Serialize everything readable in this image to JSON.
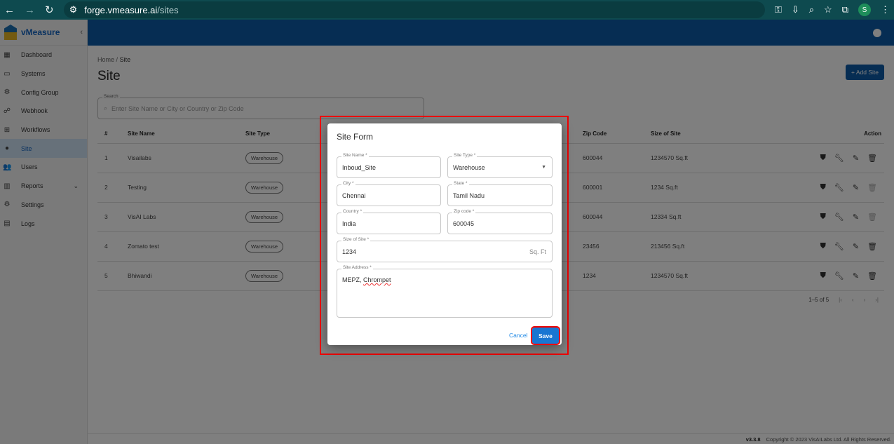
{
  "browser": {
    "url_host": "forge.vmeasure.ai",
    "url_path": "/sites",
    "profile": "S"
  },
  "sidebar": {
    "brand": "vMeasure",
    "items": [
      {
        "label": "Dashboard",
        "icon": "dashboard-icon"
      },
      {
        "label": "Systems",
        "icon": "devices-icon"
      },
      {
        "label": "Config Group",
        "icon": "gear-icon"
      },
      {
        "label": "Webhook",
        "icon": "webhook-icon"
      },
      {
        "label": "Workflows",
        "icon": "workflow-icon"
      },
      {
        "label": "Site",
        "icon": "location-icon",
        "active": true
      },
      {
        "label": "Users",
        "icon": "users-icon"
      },
      {
        "label": "Reports",
        "icon": "chart-icon"
      },
      {
        "label": "Settings",
        "icon": "gear-icon"
      },
      {
        "label": "Logs",
        "icon": "logs-icon"
      }
    ]
  },
  "page": {
    "breadcrumb_home": "Home",
    "breadcrumb_sep": "/",
    "breadcrumb_current": "Site",
    "title": "Site",
    "add_button": "+ Add Site",
    "search_label": "Search",
    "search_placeholder": "Enter Site Name or City or Country or Zip Code"
  },
  "table": {
    "headers": [
      "#",
      "Site Name",
      "Site Type",
      "Zip Code",
      "Size of Site",
      "Action"
    ],
    "rows": [
      {
        "n": "1",
        "name": "Visailabs",
        "type": "Warehouse",
        "zip": "600044",
        "size": "1234570 Sq.ft",
        "delete_enabled": true
      },
      {
        "n": "2",
        "name": "Testing",
        "type": "Warehouse",
        "zip": "600001",
        "size": "1234 Sq.ft",
        "delete_enabled": false
      },
      {
        "n": "3",
        "name": "VisAI Labs",
        "type": "Warehouse",
        "zip": "600044",
        "size": "12334 Sq.ft",
        "delete_enabled": false
      },
      {
        "n": "4",
        "name": "Zomato test",
        "type": "Warehouse",
        "zip": "23456",
        "size": "213456 Sq.ft",
        "delete_enabled": true
      },
      {
        "n": "5",
        "name": "Bhiwandi",
        "type": "Warehouse",
        "zip": "1234",
        "size": "1234570 Sq.ft",
        "delete_enabled": true
      }
    ],
    "pagination": "1–5 of 5"
  },
  "footer": {
    "version": "v3.3.8",
    "copyright": "Copyright © 2023 VisAILabs Ltd. All Rights Reserved."
  },
  "dialog": {
    "title": "Site Form",
    "site_name_label": "Site Name *",
    "site_name": "Inboud_Site",
    "site_type_label": "Site Type *",
    "site_type": "Warehouse",
    "city_label": "City *",
    "city": "Chennai",
    "state_label": "State *",
    "state": "Tamil Nadu",
    "country_label": "Country *",
    "country": "India",
    "zip_label": "Zip code *",
    "zip": "600045",
    "size_label": "Size of Site *",
    "size": "1234",
    "size_unit": "Sq. Ft",
    "address_label": "Site Address *",
    "address_part1": "MEPZ, ",
    "address_part2": "Chrompet",
    "cancel": "Cancel",
    "save": "Save"
  }
}
